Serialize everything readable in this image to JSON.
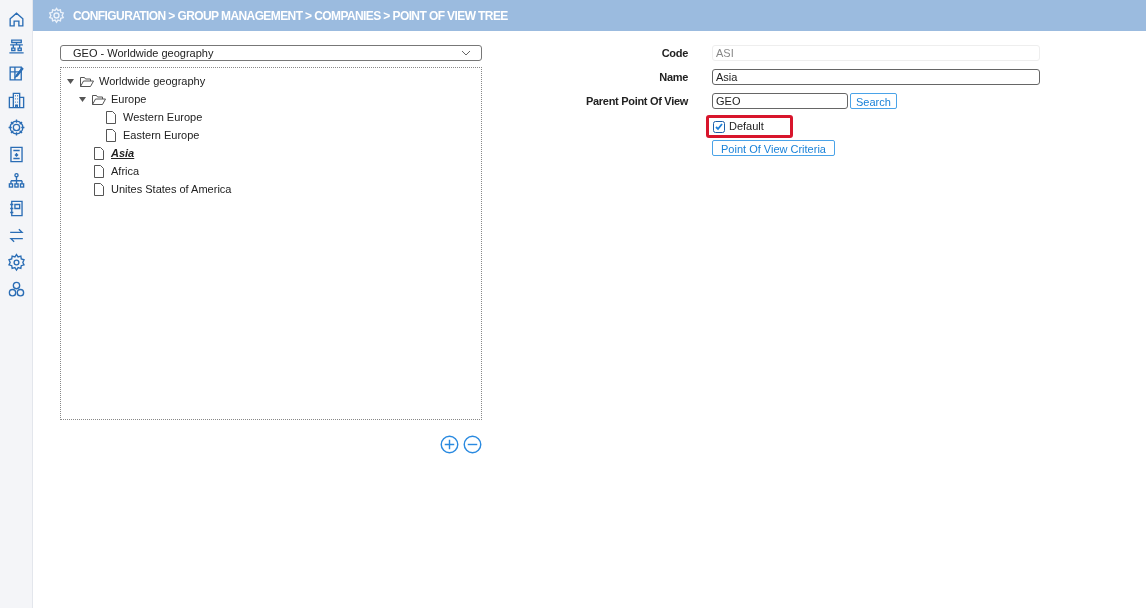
{
  "header": {
    "breadcrumb": "CONFIGURATION > GROUP MANAGEMENT > COMPANIES > POINT OF VIEW TREE"
  },
  "tree_selector": {
    "value": "GEO - Worldwide geography"
  },
  "tree": [
    {
      "label": "Worldwide geography",
      "kind": "folder",
      "expanded": true,
      "selected": false,
      "children": [
        {
          "label": "Europe",
          "kind": "folder",
          "expanded": true,
          "selected": false,
          "children": [
            {
              "label": "Western Europe",
              "kind": "leaf",
              "selected": false
            },
            {
              "label": "Eastern Europe",
              "kind": "leaf",
              "selected": false
            }
          ]
        },
        {
          "label": "Asia",
          "kind": "leaf",
          "selected": true
        },
        {
          "label": "Africa",
          "kind": "leaf",
          "selected": false
        },
        {
          "label": "Unites States of America",
          "kind": "leaf",
          "selected": false
        }
      ]
    }
  ],
  "form": {
    "fields": [
      {
        "label": "Code",
        "value": "ASI",
        "disabled": true,
        "kind": "wide"
      },
      {
        "label": "Name",
        "value": "Asia",
        "disabled": false,
        "kind": "wide"
      },
      {
        "label": "Parent Point Of View",
        "value": "GEO",
        "disabled": false,
        "kind": "search",
        "button": "Search"
      }
    ],
    "default_checkbox": {
      "label": "Default",
      "checked": true,
      "highlighted": true
    },
    "criteria_button": "Point Of View Criteria"
  }
}
